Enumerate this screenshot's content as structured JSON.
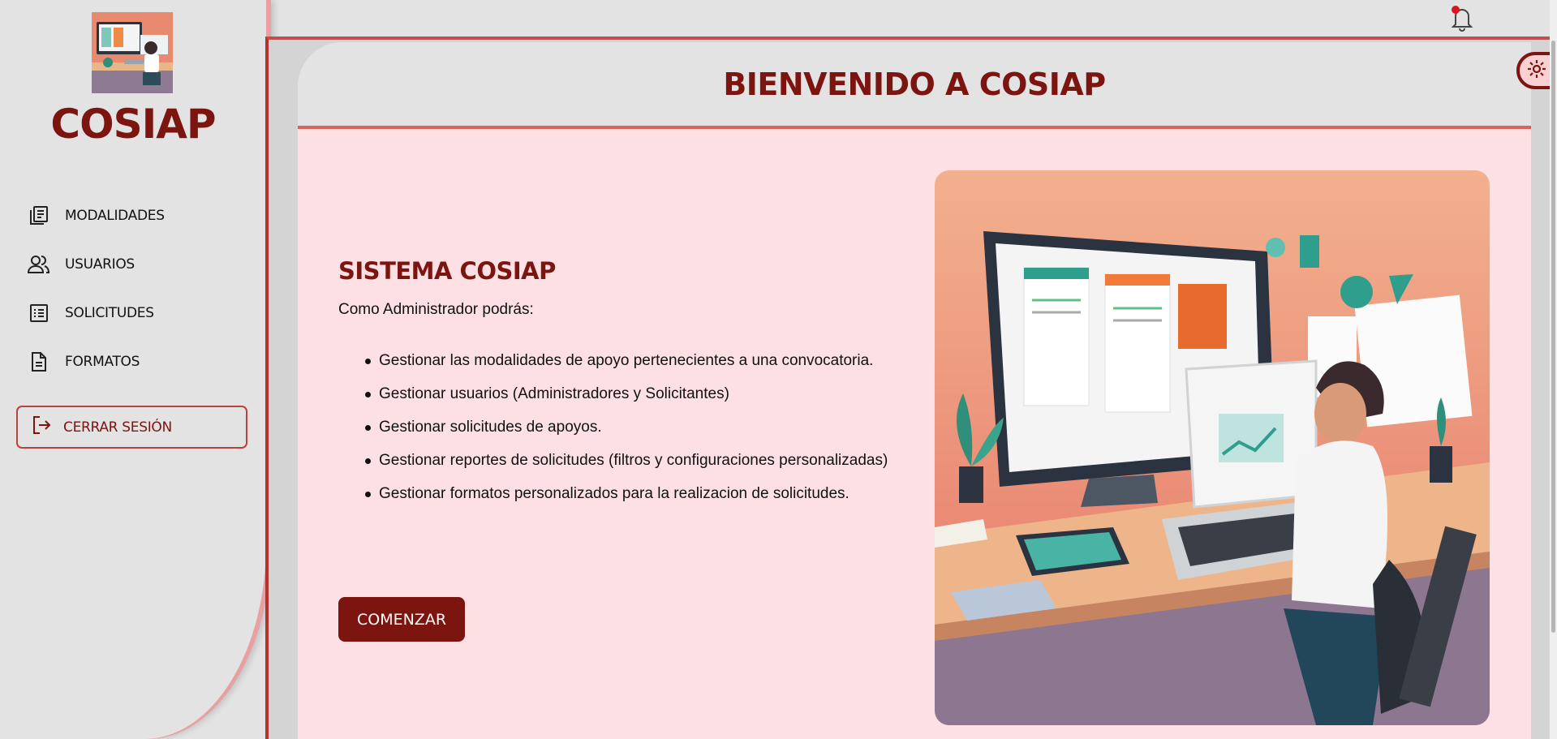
{
  "sidebar": {
    "brand": "COSIAP",
    "items": [
      {
        "label": "MODALIDADES",
        "icon": "modalidades-icon"
      },
      {
        "label": "USUARIOS",
        "icon": "users-icon"
      },
      {
        "label": "SOLICITUDES",
        "icon": "list-icon"
      },
      {
        "label": "FORMATOS",
        "icon": "document-icon"
      }
    ],
    "logout_label": "CERRAR SESIÓN"
  },
  "header": {
    "title": "BIENVENIDO A COSIAP"
  },
  "main": {
    "system_title": "SISTEMA COSIAP",
    "intro": "Como Administrador podrás:",
    "features": [
      "Gestionar las modalidades de apoyo pertenecientes a una convocatoria.",
      "Gestionar usuarios (Administradores y Solicitantes)",
      "Gestionar solicitudes de apoyos.",
      "Gestionar reportes de solicitudes (filtros y configuraciones personalizadas)",
      "Gestionar formatos personalizados para la realizacion de solicitudes."
    ],
    "start_label": "COMENZAR"
  },
  "colors": {
    "brand": "#7c1410",
    "accent": "#d9625c",
    "panel_bg": "#fce0e3",
    "sidebar_bg": "#e3e3e3"
  }
}
